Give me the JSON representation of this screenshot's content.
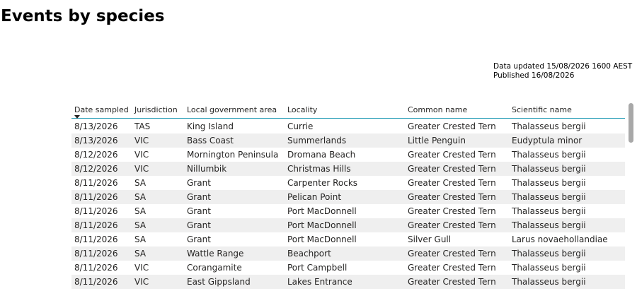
{
  "page": {
    "title": "Events by species",
    "data_updated": "Data updated 15/08/2026 1600 AEST",
    "published": "Published 16/08/2026"
  },
  "table": {
    "columns": [
      "Date sampled",
      "Jurisdiction",
      "Local government area",
      "Locality",
      "Common name",
      "Scientific name"
    ],
    "sort_column": "Date sampled",
    "rows": [
      [
        "8/13/2026",
        "TAS",
        "King Island",
        "Currie",
        "Greater Crested Tern",
        "Thalasseus bergii"
      ],
      [
        "8/13/2026",
        "VIC",
        "Bass Coast",
        "Summerlands",
        "Little Penguin",
        "Eudyptula minor"
      ],
      [
        "8/12/2026",
        "VIC",
        "Mornington Peninsula",
        "Dromana Beach",
        "Greater Crested Tern",
        "Thalasseus bergii"
      ],
      [
        "8/12/2026",
        "VIC",
        "Nillumbik",
        "Christmas Hills",
        "Greater Crested Tern",
        "Thalasseus bergii"
      ],
      [
        "8/11/2026",
        "SA",
        "Grant",
        "Carpenter Rocks",
        "Greater Crested Tern",
        "Thalasseus bergii"
      ],
      [
        "8/11/2026",
        "SA",
        "Grant",
        "Pelican Point",
        "Greater Crested Tern",
        "Thalasseus bergii"
      ],
      [
        "8/11/2026",
        "SA",
        "Grant",
        "Port MacDonnell",
        "Greater Crested Tern",
        "Thalasseus bergii"
      ],
      [
        "8/11/2026",
        "SA",
        "Grant",
        "Port MacDonnell",
        "Greater Crested Tern",
        "Thalasseus bergii"
      ],
      [
        "8/11/2026",
        "SA",
        "Grant",
        "Port MacDonnell",
        "Silver Gull",
        "Larus novaehollandiae"
      ],
      [
        "8/11/2026",
        "SA",
        "Wattle Range",
        "Beachport",
        "Greater Crested Tern",
        "Thalasseus bergii"
      ],
      [
        "8/11/2026",
        "VIC",
        "Corangamite",
        "Port Campbell",
        "Greater Crested Tern",
        "Thalasseus bergii"
      ],
      [
        "8/11/2026",
        "VIC",
        "East Gippsland",
        "Lakes Entrance",
        "Greater Crested Tern",
        "Thalasseus bergii"
      ]
    ]
  },
  "colors": {
    "header_rule": "#2b9fb8",
    "row_stripe": "#efefef",
    "scrollbar": "#a8a8a8"
  }
}
